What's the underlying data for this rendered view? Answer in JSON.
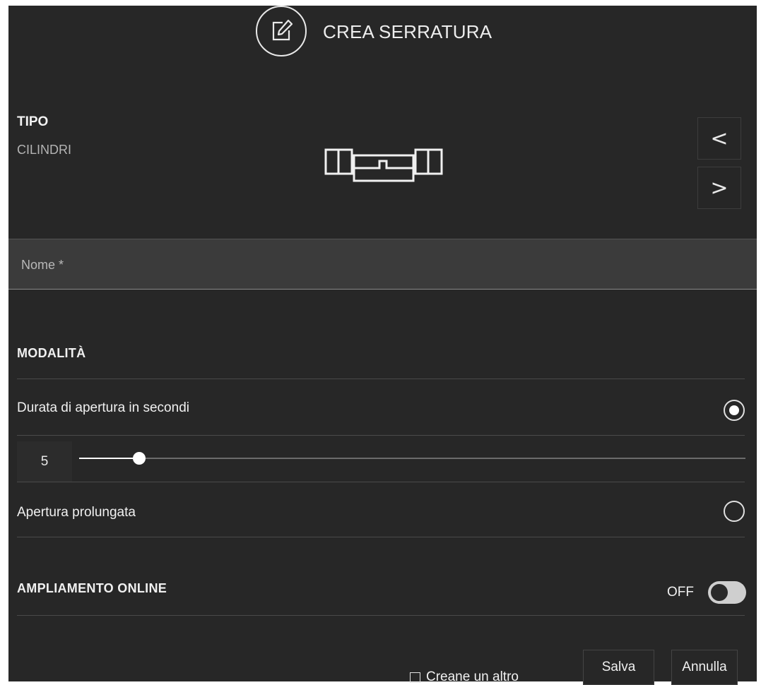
{
  "header": {
    "title": "CREA SERRATURA",
    "icon": "edit-icon"
  },
  "type": {
    "label": "TIPO",
    "value": "CILINDRI",
    "icon": "cylinder-lock-icon",
    "prev_label": "<",
    "next_label": ">"
  },
  "name_field": {
    "placeholder": "Nome *",
    "value": ""
  },
  "mode": {
    "title": "MODALITÀ",
    "options": [
      {
        "label": "Durata di apertura in secondi",
        "selected": true
      },
      {
        "label": "Apertura prolungata",
        "selected": false
      }
    ],
    "duration": {
      "value": "5",
      "slider_fraction": 0.09
    }
  },
  "online": {
    "title": "AMPLIAMENTO ONLINE",
    "state_label": "OFF",
    "enabled": false
  },
  "footer": {
    "create_another_label": "Creane un altro",
    "create_another_checked": false,
    "save_label": "Salva",
    "cancel_label": "Annulla"
  },
  "colors": {
    "background": "#272727",
    "field": "#3b3b3b",
    "text": "#f0f0f0",
    "muted": "#b4b4b4"
  }
}
